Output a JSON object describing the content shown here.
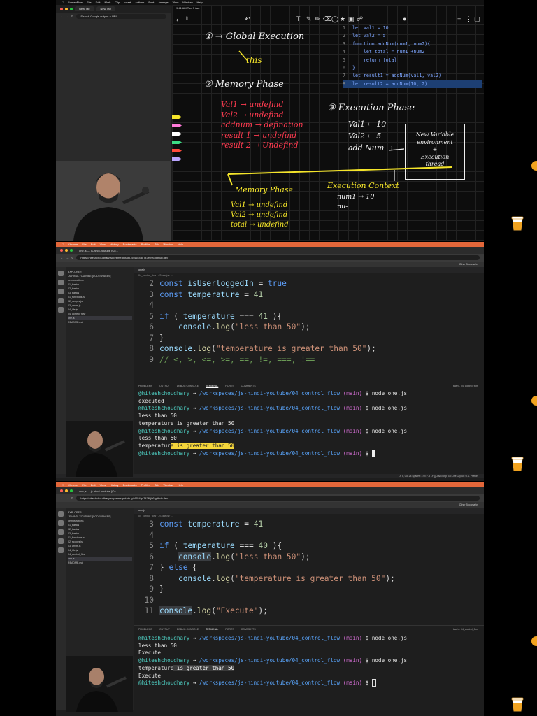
{
  "panel1": {
    "menubar": [
      "ScreenFlow",
      "File",
      "Edit",
      "Mark",
      "Clip",
      "Insert",
      "Actions",
      "Font",
      "Arrange",
      "View",
      "Window",
      "Help"
    ],
    "browser": {
      "tabs": [
        "New Tab",
        "New Tab"
      ],
      "url_placeholder": "Search Google or type a URL"
    },
    "board": {
      "status_time": "9:41 AM  Tue 9 Jan",
      "notes": {
        "global": "① → Global Execution",
        "this": "this",
        "memory_title": "② Memory Phase",
        "mem_lines": [
          "Val1 → undefind",
          "Val2 → undefind",
          "addnum → defination",
          "result 1 → undefind",
          "result 2 → Undefind"
        ],
        "exec_title": "③ Execution Phase",
        "exec_lines": [
          "Val1 ← 10",
          "Val2 ← 5",
          "add Num →"
        ],
        "box_lines": [
          "New Variable",
          "environment",
          "+",
          "Execution",
          "thread"
        ],
        "memory2_title": "Memory Phase",
        "mem2_lines": [
          "Val1 → undefind",
          "Val2 → undefind",
          "total → undefind"
        ],
        "exec_context": "Execution Context",
        "ctx_lines": [
          "num1 → 10",
          "nu-"
        ]
      },
      "code": [
        {
          "n": "1",
          "t": "let val1 = 10"
        },
        {
          "n": "2",
          "t": "let val2 = 5"
        },
        {
          "n": "3",
          "t": "function addNum(num1, num2){"
        },
        {
          "n": "4",
          "t": "    let total = num1 +num2"
        },
        {
          "n": "5",
          "t": "    return total"
        },
        {
          "n": "6",
          "t": "}"
        },
        {
          "n": "7",
          "t": "let result1 = addNum(val1, val2)"
        },
        {
          "n": "8",
          "t": "let result2 = addNum(10, 2)"
        }
      ]
    }
  },
  "panel2": {
    "menubar": [
      "Chrome",
      "File",
      "Edit",
      "View",
      "History",
      "Bookmarks",
      "Profiles",
      "Tab",
      "Window",
      "Help"
    ],
    "tab": "one.js — js-hindi-youtube [Co...",
    "url": "https://hiteshchoudhary-supreme-potato-g44654qq747f9j96.github.dev",
    "bookmarks": "Other Bookmarks",
    "explorer_title": "EXPLORER",
    "explorer": [
      "JS-HINDI-YOUTUBE [CODESPACES]",
      "  demostrations",
      "  01_basics",
      "  02_basics",
      "  03_basics",
      "  01_functions.js",
      "  02_scopes.js",
      "  03_arrow.js",
      "  04_iife.js",
      "  04_control_flow",
      "    one.js",
      "  README.md"
    ],
    "editor_tab": "one.js",
    "crumbs": "04_control_flow › JS one.js › ...",
    "code": [
      {
        "n": "2",
        "t": "const isUserloggedIn = true"
      },
      {
        "n": "3",
        "t": "const temperature = 41"
      },
      {
        "n": "4",
        "t": ""
      },
      {
        "n": "5",
        "t": "if ( temperature === 41 ){"
      },
      {
        "n": "6",
        "t": "    console.log(\"less than 50\");"
      },
      {
        "n": "7",
        "t": "}"
      },
      {
        "n": "8",
        "t": "console.log(\"temperature is greater than 50\");"
      },
      {
        "n": "9",
        "t": "// <, >, <=, >=, ==, !=, ===, !=="
      }
    ],
    "panel_tabs": [
      "PROBLEMS",
      "OUTPUT",
      "DEBUG CONSOLE",
      "TERMINAL",
      "PORTS",
      "COMMENTS"
    ],
    "terminal_label": "bash - 04_control_flow",
    "prompt_user": "@hiteshchoudhary",
    "prompt_path": "/workspaces/js-hindi-youtube/04_control_flow",
    "prompt_branch": "(main)",
    "cmd": "$ node one.js",
    "prompt_end": "$",
    "out_executed": "executed",
    "out_less": "less than 50",
    "out_temp": "temperature is greater than 50",
    "out_temp_pre": "temperatur",
    "out_temp_sel": "e is greater than 50",
    "status": "Ln 5, Col 24   Spaces: 4   UTF-8   LF   {} JavaScript   Go Live   Layout: U.S.   Prettier"
  },
  "panel3": {
    "crumbs": "04_control_flow › JS one.js › ...",
    "code": [
      {
        "n": "3",
        "t": "const temperature = 41"
      },
      {
        "n": "4",
        "t": ""
      },
      {
        "n": "5",
        "t": "if ( temperature === 40 ){"
      },
      {
        "n": "6",
        "t": "    console.log(\"less than 50\");"
      },
      {
        "n": "7",
        "t": "} else {"
      },
      {
        "n": "8",
        "t": "    console.log(\"temperature is greater than 50\");"
      },
      {
        "n": "9",
        "t": "}"
      },
      {
        "n": "10",
        "t": ""
      },
      {
        "n": "11",
        "t": "console.log(\"Execute\");"
      }
    ],
    "out_execute": "Execute",
    "out_less": "less than 50",
    "out_temp_pre": "temperature",
    "out_temp_sel": " is greater than 50"
  },
  "colors": {
    "accent": "#e3673a",
    "note_yellow": "#f5e52a",
    "note_red": "#ff3b50",
    "term_user": "#4fd1c5"
  }
}
